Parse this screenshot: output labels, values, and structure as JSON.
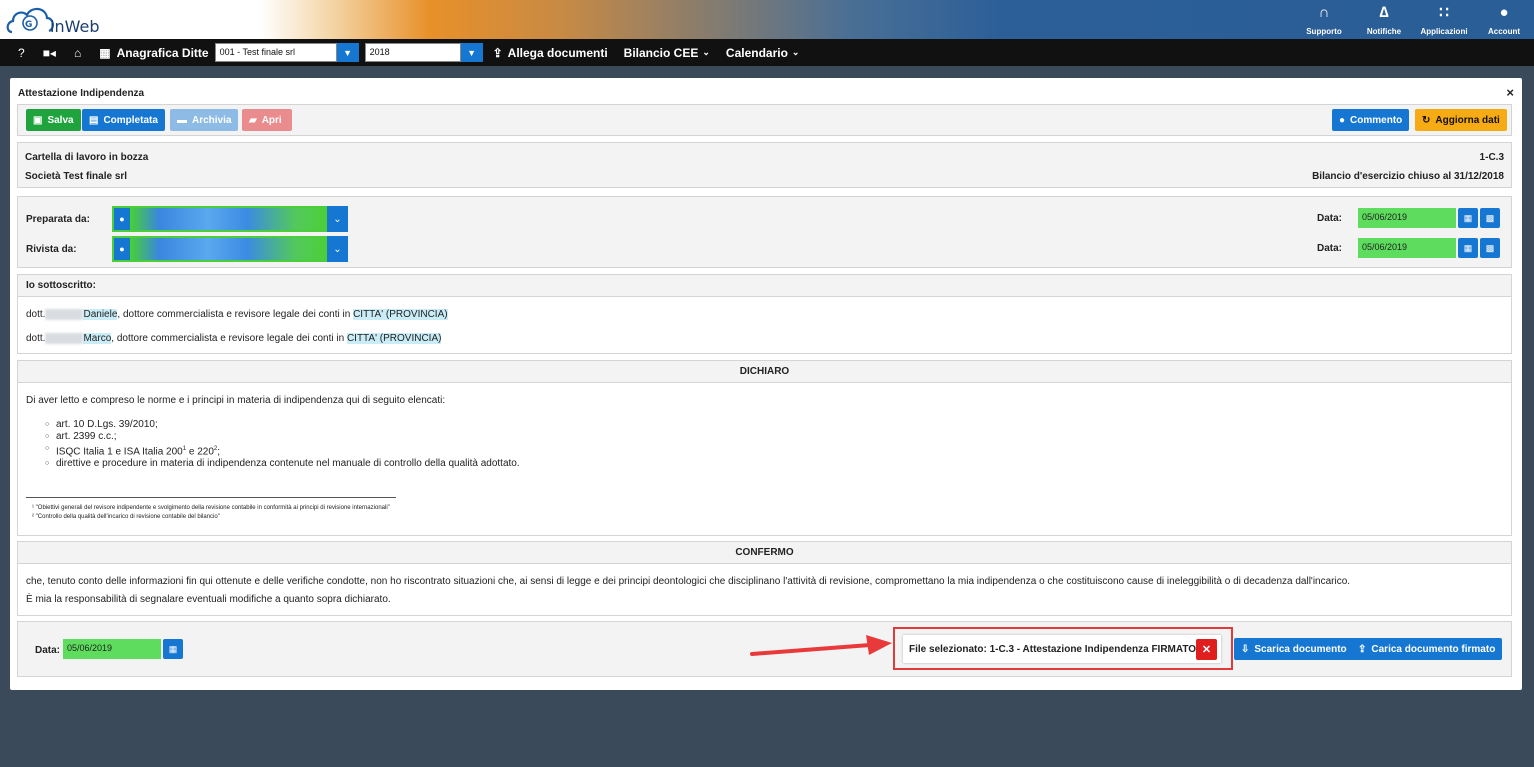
{
  "brand": {
    "name": "inWeb"
  },
  "top_menu": [
    {
      "label": "Supporto",
      "icon": "headset-icon",
      "glyph": "∩"
    },
    {
      "label": "Notifiche",
      "icon": "bell-icon",
      "glyph": "∆"
    },
    {
      "label": "Applicazioni",
      "icon": "grid-icon",
      "glyph": "∷"
    },
    {
      "label": "Account",
      "icon": "user-circle-icon",
      "glyph": "●"
    }
  ],
  "nav": {
    "anagrafica_label": "Anagrafica Ditte",
    "company_select": "001 - Test finale srl",
    "year_select": "2018",
    "allega_label": "Allega documenti",
    "bilancio_label": "Bilancio CEE",
    "calendario_label": "Calendario"
  },
  "panel": {
    "title": "Attestazione Indipendenza",
    "close": "×"
  },
  "toolbar": {
    "salva": "Salva",
    "completata": "Completata",
    "archivia": "Archivia",
    "apri": "Apri",
    "commento": "Commento",
    "aggiorna": "Aggiorna dati"
  },
  "info": {
    "status": "Cartella di lavoro in bozza",
    "code": "1-C.3",
    "company": "Società Test finale srl",
    "period": "Bilancio d'esercizio chiuso al 31/12/2018"
  },
  "signatures": {
    "preparata_label": "Preparata da:",
    "rivista_label": "Rivista da:",
    "data_label": "Data:",
    "preparata_date": "05/06/2019",
    "rivista_date": "05/06/2019"
  },
  "sottoscritto": {
    "heading": "Io sottoscritto:",
    "rows": [
      {
        "prefix": "dott.",
        "name": "Daniele",
        "text": ", dottore commercialista e revisore legale dei conti in ",
        "city": "CITTA' (PROVINCIA)"
      },
      {
        "prefix": "dott.",
        "name": "Marco",
        "text": ", dottore commercialista e revisore legale dei conti in ",
        "city": "CITTA' (PROVINCIA)"
      }
    ]
  },
  "dichiaro": {
    "heading": "DICHIARO",
    "intro": "Di aver letto e compreso le norme e i principi in materia di indipendenza qui di seguito elencati:",
    "item1": "art. 10 D.Lgs. 39/2010;",
    "item2": "art. 2399 c.c.;",
    "item3_a": "ISQC Italia 1 e ISA Italia 200",
    "item3_sup1": "1",
    "item3_b": " e 220",
    "item3_sup2": "2",
    "item3_c": ";",
    "item4": "direttive e procedure in materia di indipendenza contenute nel manuale di controllo della qualità adottato.",
    "note1": "¹ \"Obiettivi generali del revisore indipendente e svolgimento della revisione contabile in conformità ai principi di revisione internazionali\"",
    "note2": "² \"Controllo della qualità dell'incarico di revisione contabile del bilancio\""
  },
  "confermo": {
    "heading": "CONFERMO",
    "p1": "che, tenuto conto delle informazioni fin qui ottenute e delle verifiche condotte, non ho riscontrato situazioni che, ai sensi di legge e dei principi deontologici che disciplinano l'attività di revisione, compromettano la mia indipendenza o che costituiscono cause di ineleggibilità o di decadenza dall'incarico.",
    "p2": "È mia la responsabilità di segnalare eventuali modifiche a quanto sopra dichiarato."
  },
  "footer": {
    "data_label": "Data:",
    "date": "05/06/2019",
    "file_selected": "File selezionato: 1-C.3 - Attestazione Indipendenza FIRMATO.pdf",
    "scarica": "Scarica documento",
    "carica": "Carica documento firmato"
  },
  "colors": {
    "primary": "#1677d2",
    "success": "#1fa33c",
    "warning": "#f6aa13",
    "danger": "#e01e1e",
    "date_bg": "#5ddc5d"
  }
}
